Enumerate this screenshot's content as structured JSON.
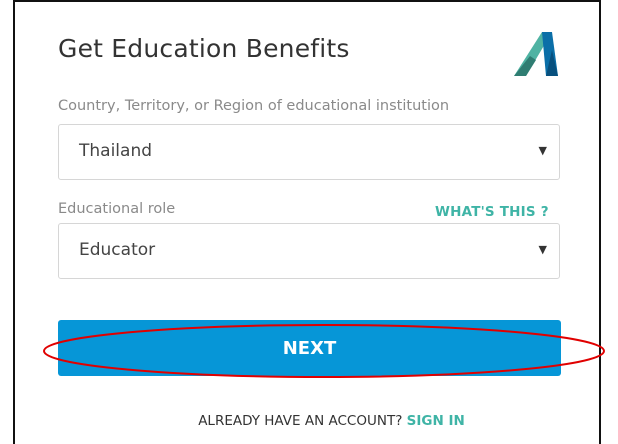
{
  "header": {
    "title": "Get Education Benefits",
    "logo_icon": "autodesk-logo-icon"
  },
  "form": {
    "country": {
      "label": "Country, Territory, or Region of educational institution",
      "value": "Thailand",
      "caret": "▼"
    },
    "role": {
      "label": "Educational role",
      "value": "Educator",
      "caret": "▼",
      "help_link": "WHAT'S THIS ?"
    },
    "next_button": "NEXT"
  },
  "footer": {
    "account_prompt": "ALREADY HAVE AN ACCOUNT?",
    "signin_link": "SIGN IN"
  },
  "colors": {
    "primary_button": "#0696d7",
    "link_teal": "#3fb4a6",
    "annotation_red": "#e00000"
  }
}
